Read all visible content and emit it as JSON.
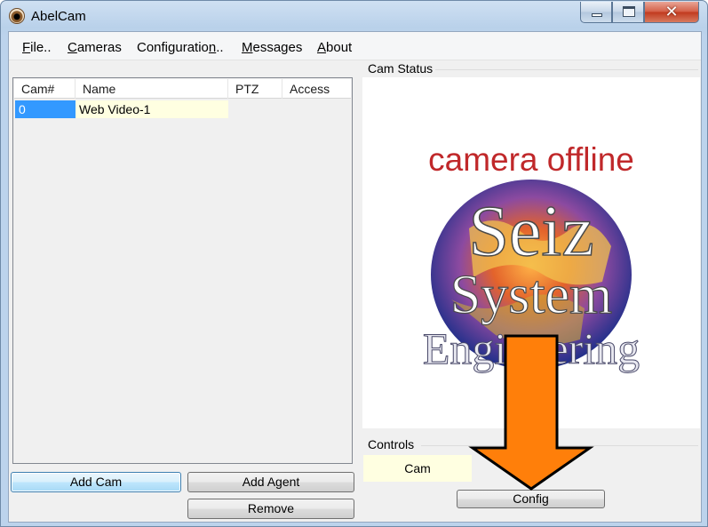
{
  "window": {
    "title": "AbelCam",
    "close_glyph": "✕"
  },
  "menu": [
    {
      "label": "File..",
      "accel": "F"
    },
    {
      "label": "Cameras",
      "accel": "C"
    },
    {
      "label": "Configuration..",
      "accel": "n"
    },
    {
      "label": "Messages",
      "accel": "M"
    },
    {
      "label": "About",
      "accel": "A"
    }
  ],
  "camera_list": {
    "columns": [
      "Cam#",
      "Name",
      "PTZ",
      "Access"
    ],
    "rows": [
      {
        "cam": "0",
        "name": "Web Video-1",
        "ptz": "",
        "access": ""
      }
    ]
  },
  "buttons": {
    "add_cam": "Add Cam",
    "add_agent": "Add Agent",
    "remove": "Remove",
    "config": "Config"
  },
  "cam_status": {
    "title": "Cam Status",
    "offline_text": "camera offline",
    "logo_lines": [
      "Seiz",
      "System",
      "Engineering"
    ]
  },
  "controls": {
    "title": "Controls",
    "cam_label": "Cam"
  },
  "colors": {
    "selection": "#3399ff",
    "info_background": "#ffffe1",
    "offline_red": "#c0282a",
    "arrow_orange": "#ff7f0a"
  }
}
